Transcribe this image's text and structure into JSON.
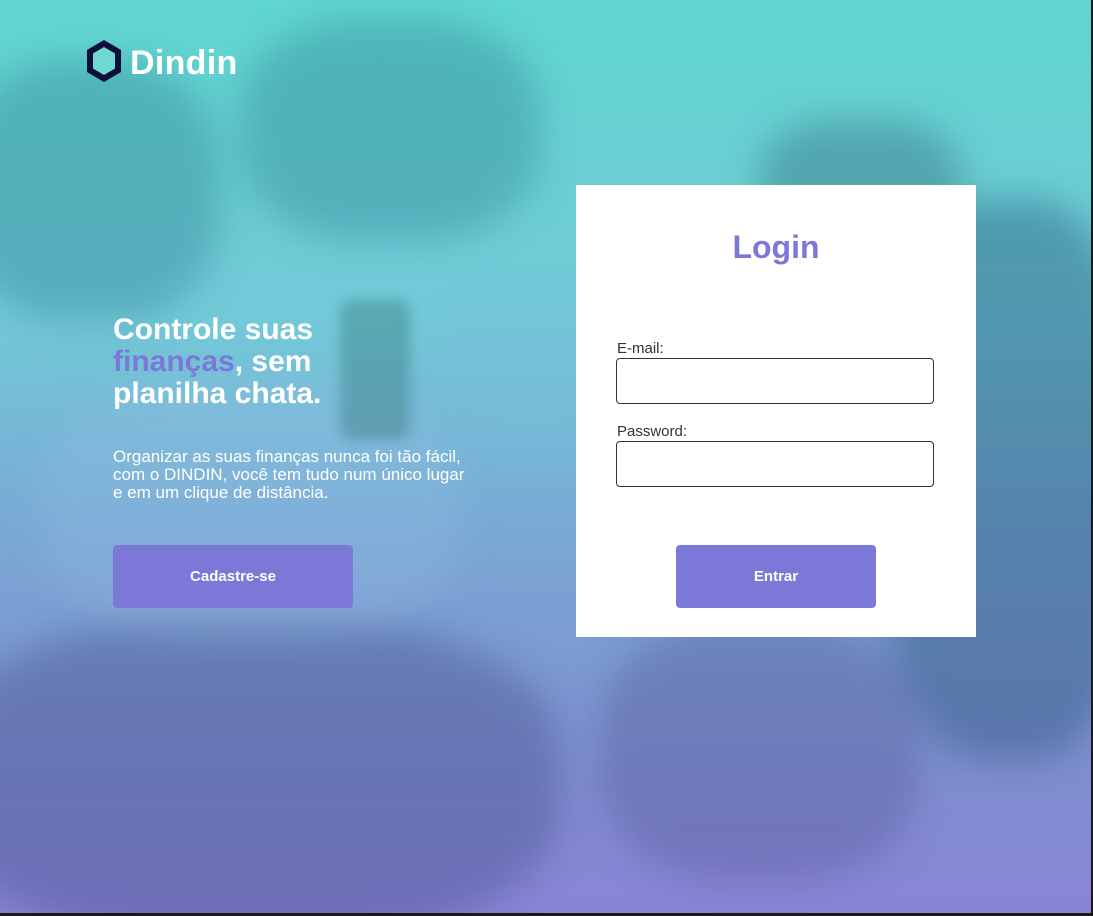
{
  "brand": {
    "name": "Dindin",
    "icon": "hexagon-logo-icon"
  },
  "hero": {
    "headline_part1": "Controle suas",
    "headline_highlight": "finanças",
    "headline_part2": ", sem planilha chata.",
    "description": "Organizar as suas finanças nunca foi tão fácil, com o DINDIN, você tem tudo num único lugar e em um clique de distância.",
    "signup_label": "Cadastre-se"
  },
  "login": {
    "title": "Login",
    "email_label": "E-mail:",
    "email_value": "",
    "password_label": "Password:",
    "password_value": "",
    "submit_label": "Entrar"
  },
  "colors": {
    "accent": "#7b78d8",
    "gradient_top": "#5fd6cf",
    "gradient_bottom": "#8a84d6",
    "logo_dark": "#0e0e3a",
    "logo_light": "#6fd8d3"
  }
}
